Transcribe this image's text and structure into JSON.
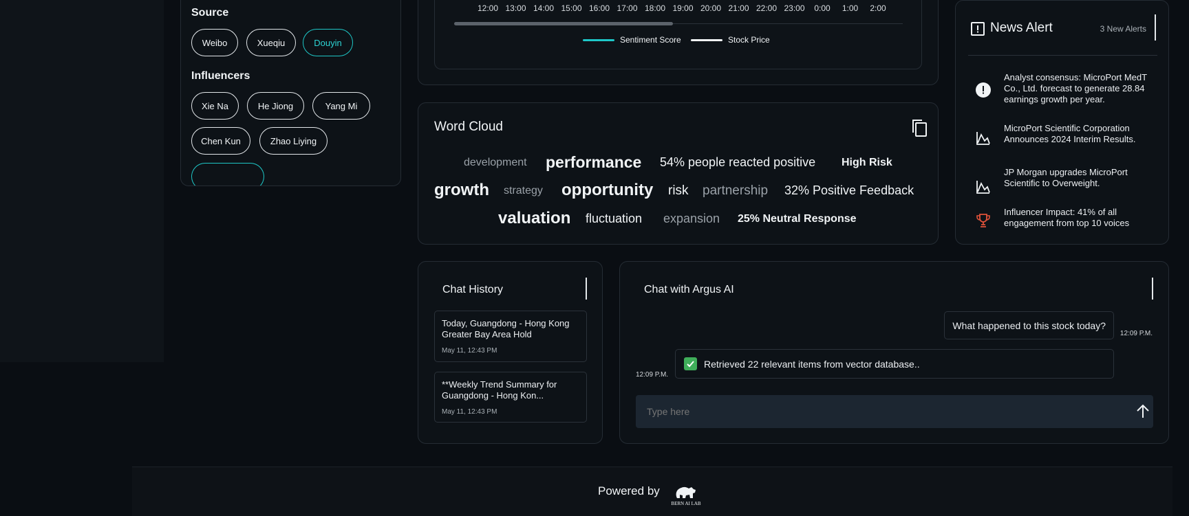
{
  "filters": {
    "source_title": "Source",
    "sources": [
      "Weibo",
      "Xueqiu",
      "Douyin"
    ],
    "influencers_title": "Influencers",
    "influencers": [
      "Xie Na",
      "He Jiong",
      "Yang Mi",
      "Chen Kun",
      "Zhao Liying"
    ]
  },
  "chart": {
    "ticks": [
      "12:00",
      "13:00",
      "14:00",
      "15:00",
      "16:00",
      "17:00",
      "18:00",
      "19:00",
      "20:00",
      "21:00",
      "22:00",
      "23:00",
      "0:00",
      "1:00",
      "2:00"
    ],
    "legend": [
      {
        "label": "Sentiment Score",
        "color": "#1ec8c8"
      },
      {
        "label": "Stock Price",
        "color": "#f1f4f6"
      }
    ]
  },
  "news": {
    "title": "News Alert",
    "count": "3 New Alerts",
    "items": [
      {
        "icon": "alert-circle-icon",
        "text": "Analyst consensus: MicroPort MedT\nCo., Ltd. forecast to generate 28.84\nearnings growth per year."
      },
      {
        "icon": "line-chart-icon",
        "text": "MicroPort Scientific Corporation\nAnnounces 2024 Interim Results."
      },
      {
        "icon": "line-chart-icon",
        "text": "JP Morgan upgrades MicroPort\nScientific to Overweight."
      },
      {
        "icon": "trophy-icon",
        "text": "Influencer Impact: 41% of all\nengagement from top 10 voices"
      }
    ]
  },
  "word_cloud": {
    "title": "Word Cloud",
    "words": [
      "development",
      "performance",
      "54% people reacted positive",
      "High Risk",
      "growth",
      "strategy",
      "opportunity",
      "risk",
      "partnership",
      "32% Positive Feedback",
      "valuation",
      "fluctuation",
      "expansion",
      "25% Neutral Response"
    ]
  },
  "history": {
    "title": "Chat History",
    "items": [
      {
        "title": "Today, Guangdong - Hong Kong Greater Bay Area Hold",
        "date": "May 11, 12:43 PM"
      },
      {
        "title": "**Weekly Trend Summary for Guangdong - Hong Kon...",
        "date": "May 11, 12:43 PM"
      }
    ]
  },
  "chat": {
    "title": "Chat with Argus AI",
    "user_message": "What happened to this stock today?",
    "user_time": "12:09 P.M.",
    "bot_message": "Retrieved 22 relevant items from vector database..",
    "bot_time": "12:09 P.M.",
    "input_placeholder": "Type here"
  },
  "footer": {
    "powered_by": "Powered by",
    "logo_text": "BERN AI LAB"
  }
}
